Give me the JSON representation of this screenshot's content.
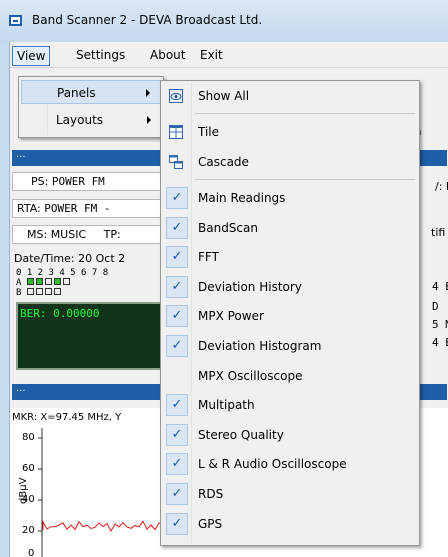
{
  "window": {
    "title": "Band Scanner 2 - DEVA Broadcast Ltd."
  },
  "menubar": {
    "items": [
      "View",
      "Settings",
      "About",
      "Exit"
    ]
  },
  "view_menu": {
    "items": [
      {
        "label": "Panels",
        "has_submenu": true,
        "highlighted": true
      },
      {
        "label": "Layouts",
        "has_submenu": true,
        "highlighted": false
      }
    ]
  },
  "panels_menu": {
    "show_all": {
      "label": "Show All",
      "icon": "show-all-icon"
    },
    "tile": {
      "label": "Tile",
      "icon": "tile-icon"
    },
    "cascade": {
      "label": "Cascade",
      "icon": "cascade-icon"
    },
    "panels": [
      {
        "label": "Main Readings",
        "checked": true
      },
      {
        "label": "BandScan",
        "checked": true
      },
      {
        "label": "FFT",
        "checked": true
      },
      {
        "label": "Deviation History",
        "checked": true
      },
      {
        "label": "MPX Power",
        "checked": true
      },
      {
        "label": "Deviation Histogram",
        "checked": true
      },
      {
        "label": "MPX Oscilloscope",
        "checked": false
      },
      {
        "label": "Multipath",
        "checked": true
      },
      {
        "label": "Stereo Quality",
        "checked": true
      },
      {
        "label": "L & R Audio Oscilloscope",
        "checked": true
      },
      {
        "label": "RDS",
        "checked": true
      },
      {
        "label": "GPS",
        "checked": true
      }
    ],
    "check_glyph": "✓"
  },
  "background": {
    "panel_header": "...",
    "ps": {
      "label": "PS:",
      "value": "POWER FM"
    },
    "rta": {
      "label": "RTA:",
      "value": "POWER FM -"
    },
    "ms": {
      "label": "MS:",
      "value": "MUSIC"
    },
    "tp": {
      "label": "TP:"
    },
    "datetime": "Date/Time: 20 Oct 2",
    "groups_numbers": "0 1 2 3 4 5 6 7 8",
    "group_a": "A",
    "group_b": "B",
    "ber": "BER: 0.00000",
    "right_snips": [
      "son",
      "/: P",
      "tifi",
      "4 E",
      "D",
      "5 M",
      "4 E"
    ],
    "mkr": "MKR: X=97.45 MHz, Y",
    "y_axis_label": "dBµV",
    "y_ticks": [
      "80",
      "60",
      "40",
      "20",
      "0"
    ]
  }
}
